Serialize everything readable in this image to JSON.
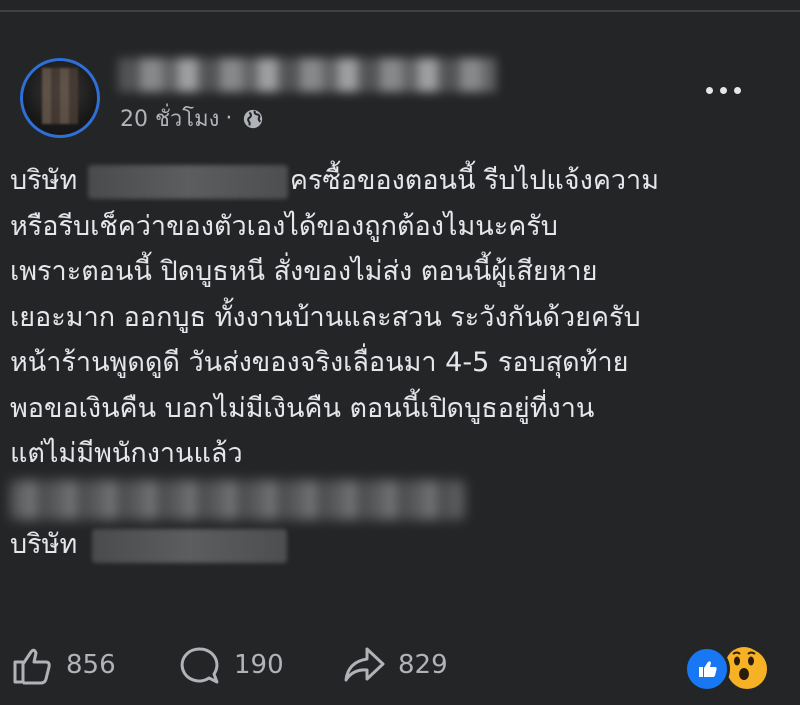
{
  "post": {
    "author_name": "",
    "time": "20 ชั่วโมง",
    "separator": "·",
    "privacy_icon": "globe-icon",
    "more_icon": "more-options-icon",
    "lines": [
      {
        "prefix": "บริษัท",
        "suffix": "ครซื้อของตอนนี้ รีบไปแจ้งความ"
      },
      "หรือรีบเช็คว่าของตัวเองได้ของถูกต้องไมนะครับ",
      "เพราะตอนนี้ ปิดบูธหนี สั่งของไม่ส่ง ตอนนี้ผู้เสียหาย",
      "เยอะมาก ออกบูธ ทั้งงานบ้านและสวน ระวังกันด้วยครับ",
      "หน้าร้านพูดดูดี วันส่งของจริงเลื่อนมา 4-5 รอบสุดท้าย",
      "พอขอเงินคืน บอกไม่มีเงินคืน ตอนนี้เปิดบูธอยู่ที่งาน",
      "แต่ไม่มีพนักงานแล้ว"
    ],
    "company_label": "บริษัท"
  },
  "footer": {
    "likes": "856",
    "comments": "190",
    "shares": "829"
  },
  "colors": {
    "background": "#242526",
    "text": "#e4e6eb",
    "muted": "#b0b3b8",
    "like_blue": "#1877f2",
    "wow_yellow": "#f7b125"
  }
}
